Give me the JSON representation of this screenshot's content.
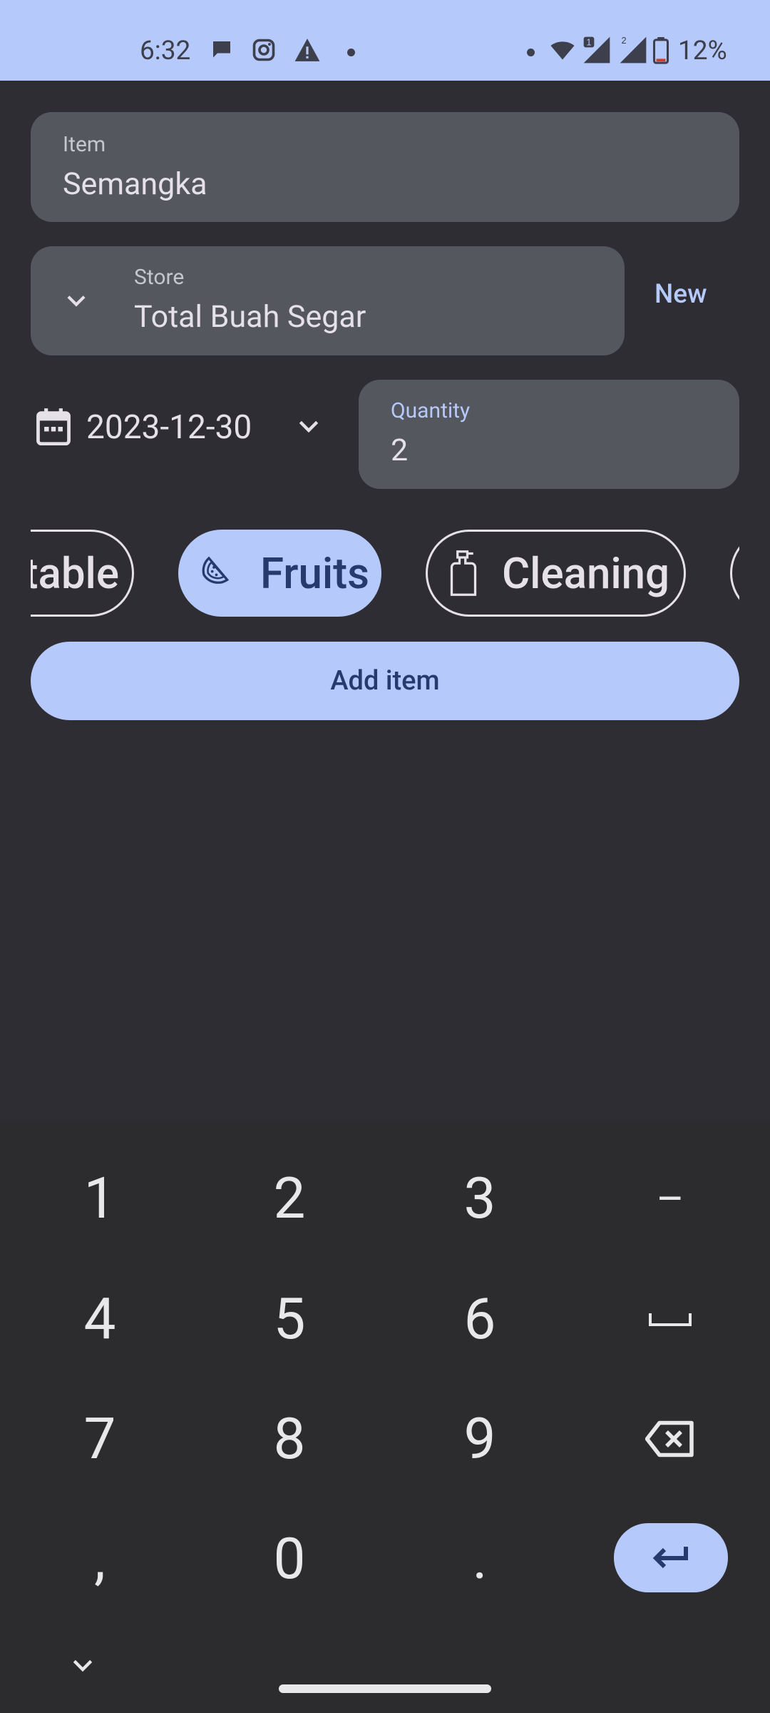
{
  "status_bar": {
    "time": "6:32",
    "battery_percent": "12%",
    "signal_sim_badge": "1",
    "signal2_badge": "2"
  },
  "form": {
    "item": {
      "label": "Item",
      "value": "Semangka"
    },
    "store": {
      "label": "Store",
      "value": "Total Buah Segar"
    },
    "new_button": "New",
    "date": "2023-12-30",
    "quantity": {
      "label": "Quantity",
      "value": "2"
    }
  },
  "categories": {
    "chips": [
      {
        "label": "table",
        "selected": false
      },
      {
        "label": "Fruits",
        "selected": true
      },
      {
        "label": "Cleaning",
        "selected": false
      }
    ]
  },
  "add_button": "Add item",
  "keyboard": {
    "keys": [
      "1",
      "2",
      "3",
      "–",
      "4",
      "5",
      "6",
      "␣",
      "7",
      "8",
      "9",
      "⌫",
      ",",
      "0",
      "."
    ]
  },
  "colors": {
    "accent": "#b5c9fb",
    "background": "#2e2d33",
    "field": "#55575f",
    "keyboard": "#2c2c2e"
  }
}
